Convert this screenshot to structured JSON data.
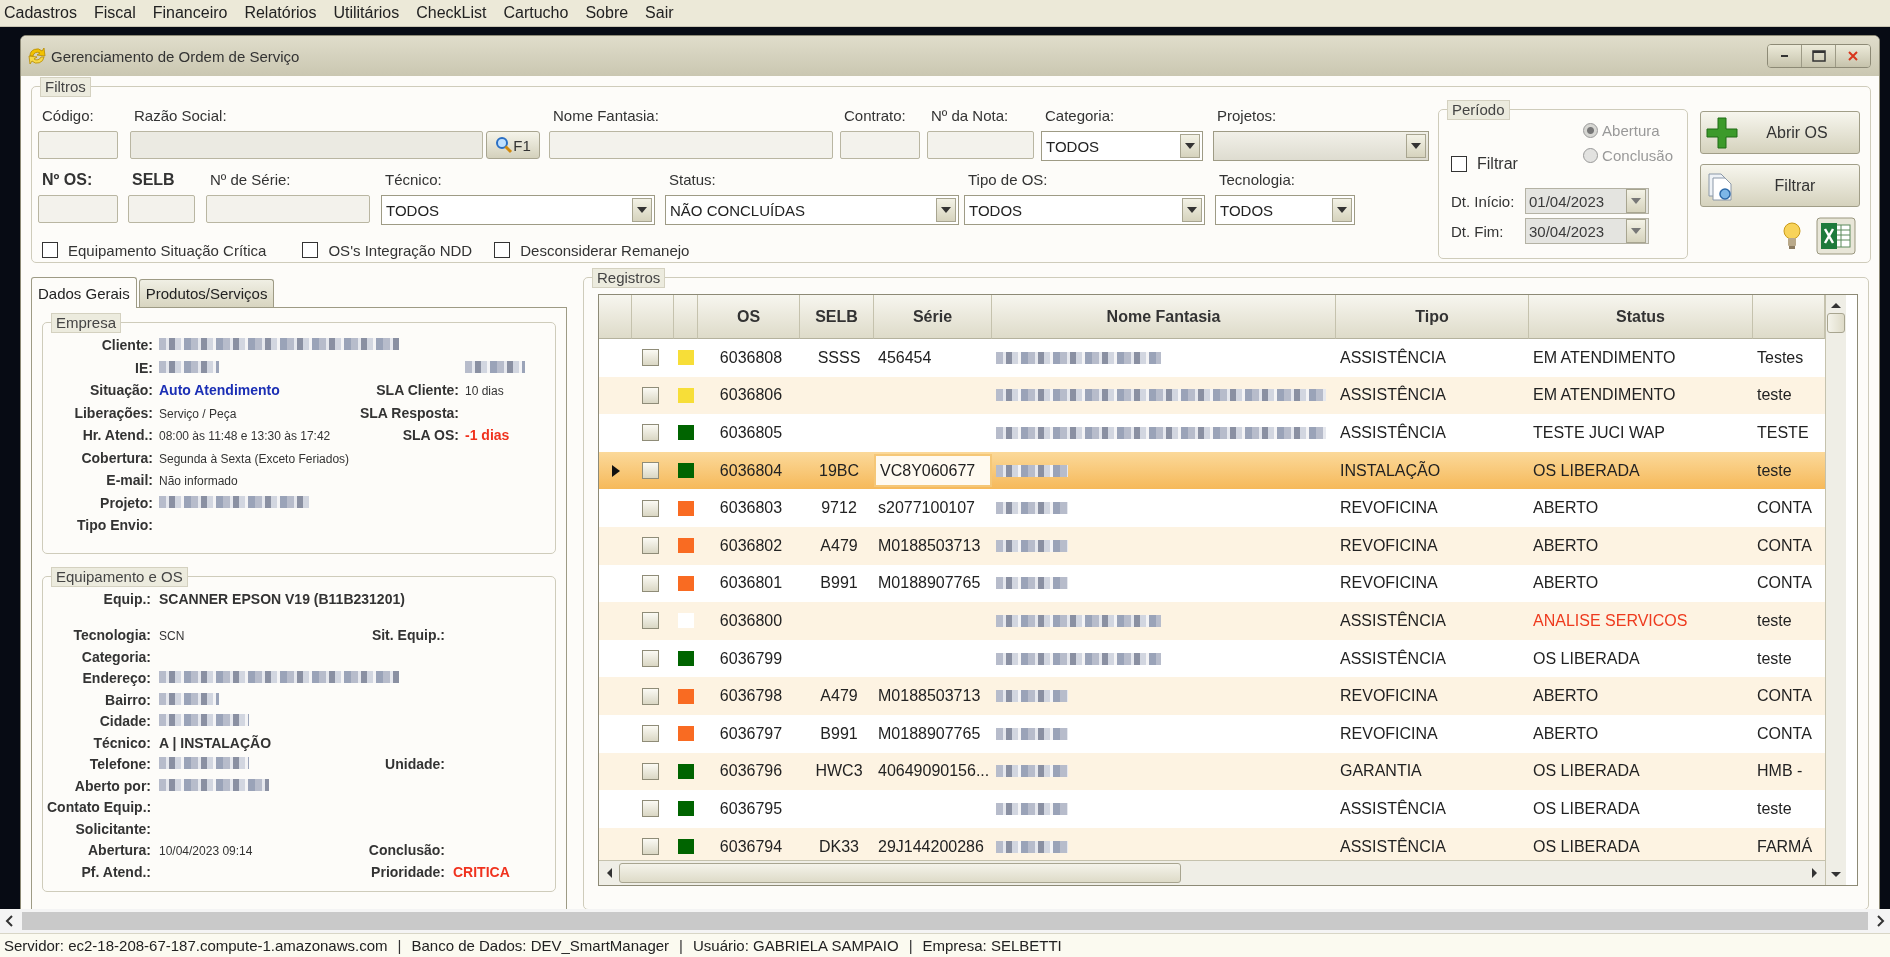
{
  "menu": [
    "Cadastros",
    "Fiscal",
    "Financeiro",
    "Relatórios",
    "Utilitários",
    "CheckList",
    "Cartucho",
    "Sobre",
    "Sair"
  ],
  "window": {
    "title": "Gerenciamento de Ordem de Serviço"
  },
  "filters": {
    "title": "Filtros",
    "search_button": "F1",
    "row1": [
      {
        "label": "Código:",
        "kind": "text",
        "bold": false
      },
      {
        "label": "Razão Social:",
        "kind": "lookup",
        "bold": false
      },
      {
        "label": "Nome Fantasia:",
        "kind": "text",
        "bold": false
      },
      {
        "label": "Contrato:",
        "kind": "text",
        "bold": false
      },
      {
        "label": "Nº da Nota:",
        "kind": "text",
        "bold": false
      },
      {
        "label": "Categoria:",
        "kind": "combo",
        "value": "TODOS",
        "bold": false
      },
      {
        "label": "Projetos:",
        "kind": "combo",
        "bold": false
      }
    ],
    "row2": [
      {
        "label": "Nº OS:",
        "kind": "text",
        "bold": true
      },
      {
        "label": "SELB",
        "kind": "text",
        "bold": true
      },
      {
        "label": "Nº de Série:",
        "kind": "text",
        "bold": false
      },
      {
        "label": "Técnico:",
        "kind": "combo",
        "value": "TODOS",
        "bold": false
      },
      {
        "label": "Status:",
        "kind": "combo",
        "value": "NÃO CONCLUÍDAS",
        "bold": false
      },
      {
        "label": "Tipo de OS:",
        "kind": "combo",
        "value": "TODOS",
        "bold": false
      },
      {
        "label": "Tecnologia:",
        "kind": "combo",
        "value": "TODOS",
        "bold": false
      }
    ],
    "checks": [
      {
        "label": "Equipamento Situação Crítica",
        "checked": false
      },
      {
        "label": "OS's Integração NDD",
        "checked": false
      },
      {
        "label": "Desconsiderar Remanejo",
        "checked": false
      }
    ]
  },
  "period": {
    "title": "Período",
    "disabled": true,
    "filter": {
      "label": "Filtrar",
      "checked": false
    },
    "options": [
      {
        "label": "Abertura",
        "selected": true
      },
      {
        "label": "Conclusão",
        "selected": false
      }
    ],
    "dates": [
      {
        "label": "Dt. Início:",
        "value": "01/04/2023"
      },
      {
        "label": "Dt. Fim:",
        "value": "30/04/2023"
      }
    ]
  },
  "actions": [
    {
      "label": "Abrir OS",
      "kind": "add"
    },
    {
      "label": "Filtrar",
      "kind": "filter"
    }
  ],
  "tabs": [
    {
      "label": "Dados Gerais",
      "selected": true
    },
    {
      "label": "Produtos/Serviços",
      "selected": false
    }
  ],
  "empresa": {
    "title": "Empresa",
    "rows": [
      {
        "label": "Cliente:",
        "kind": "redacted"
      },
      {
        "label": "IE:",
        "kind": "redacted",
        "right": {
          "kind": "redacted"
        }
      },
      {
        "label": "Situação:",
        "value": "Auto Atendimento",
        "kind": "link",
        "right": {
          "label": "SLA Cliente:",
          "value": "10 dias",
          "kind": "small"
        }
      },
      {
        "label": "Liberações:",
        "value": "Serviço / Peça",
        "kind": "small",
        "right": {
          "label": "SLA Resposta:"
        }
      },
      {
        "label": "Hr. Atend.:",
        "value": "08:00 às 11:48 e 13:30 às 17:42",
        "kind": "small",
        "right": {
          "label": "SLA OS:",
          "value": "-1 dias",
          "kind": "alert"
        }
      },
      {
        "label": "Cobertura:",
        "value": "Segunda à Sexta (Exceto Feriados)",
        "kind": "small"
      },
      {
        "label": "E-mail:",
        "value": "Não informado",
        "kind": "small"
      },
      {
        "label": "Projeto:",
        "kind": "redacted"
      },
      {
        "label": "Tipo Envio:"
      }
    ]
  },
  "equipamento": {
    "title": "Equipamento e OS",
    "rows": [
      {
        "label": "Equip.:",
        "value": "SCANNER EPSON V19 (B11B231201)",
        "kind": "bold"
      },
      {
        "label": "Tecnologia:",
        "value": "SCN",
        "kind": "small",
        "right": {
          "label": "Sit. Equip.:"
        }
      },
      {
        "label": "Categoria:"
      },
      {
        "label": "Endereço:",
        "kind": "redacted"
      },
      {
        "label": "Bairro:",
        "kind": "redacted"
      },
      {
        "label": "Cidade:",
        "kind": "redacted"
      },
      {
        "label": "Técnico:",
        "value": "A | INSTALAÇÃO",
        "kind": "bold"
      },
      {
        "label": "Telefone:",
        "kind": "redacted",
        "right": {
          "label": "Unidade:"
        }
      },
      {
        "label": "Aberto por:",
        "kind": "redacted"
      },
      {
        "label": "Contato Equip.:"
      },
      {
        "label": "Solicitante:"
      },
      {
        "label": "Abertura:",
        "value": "10/04/2023 09:14",
        "kind": "small",
        "right": {
          "label": "Conclusão:"
        }
      },
      {
        "label": "Pf. Atend.:",
        "right": {
          "label": "Prioridade:",
          "value": "CRITICA",
          "kind": "alert"
        }
      }
    ]
  },
  "registros": {
    "title": "Registros",
    "columns": [
      "OS",
      "SELB",
      "Série",
      "Nome Fantasia",
      "Tipo",
      "Status"
    ],
    "rows": [
      {
        "os": "6036808",
        "selb": "SSSS",
        "serie": "456454",
        "name_redacted": true,
        "tipo": "ASSISTÊNCIA",
        "status": "EM ATENDIMENTO",
        "alert": false,
        "extra": "Testes",
        "color": "#f7de38",
        "checked": false,
        "selected": false
      },
      {
        "os": "6036806",
        "name_redacted": true,
        "tipo": "ASSISTÊNCIA",
        "status": "EM ATENDIMENTO",
        "alert": false,
        "extra": "teste",
        "color": "#f7de38",
        "checked": false,
        "selected": false
      },
      {
        "os": "6036805",
        "name_redacted": true,
        "tipo": "ASSISTÊNCIA",
        "status": "TESTE JUCI WAP",
        "alert": false,
        "extra": "TESTE",
        "color": "#006400",
        "checked": false,
        "selected": false
      },
      {
        "os": "6036804",
        "selb": "19BC",
        "serie": "VC8Y060677",
        "name_redacted": true,
        "tipo": "INSTALAÇÃO",
        "status": "OS LIBERADA",
        "alert": false,
        "extra": "teste",
        "color": "#006400",
        "checked": false,
        "selected": true
      },
      {
        "os": "6036803",
        "selb": "9712",
        "serie": "s2077100107",
        "name_redacted": true,
        "tipo": "REVOFICINA",
        "status": "ABERTO",
        "alert": false,
        "extra": "CONTA",
        "color": "#f96b22",
        "checked": false,
        "selected": false
      },
      {
        "os": "6036802",
        "selb": "A479",
        "serie": "M0188503713",
        "name_redacted": true,
        "tipo": "REVOFICINA",
        "status": "ABERTO",
        "alert": false,
        "extra": "CONTA",
        "color": "#f96b22",
        "checked": false,
        "selected": false
      },
      {
        "os": "6036801",
        "selb": "B991",
        "serie": "M0188907765",
        "name_redacted": true,
        "tipo": "REVOFICINA",
        "status": "ABERTO",
        "alert": false,
        "extra": "CONTA",
        "color": "#f96b22",
        "checked": false,
        "selected": false
      },
      {
        "os": "6036800",
        "name_redacted": true,
        "tipo": "ASSISTÊNCIA",
        "status": "ANALISE SERVICOS",
        "alert": true,
        "extra": "teste",
        "color": "#ffffff",
        "checked": false,
        "selected": false
      },
      {
        "os": "6036799",
        "name_redacted": true,
        "tipo": "ASSISTÊNCIA",
        "status": "OS LIBERADA",
        "alert": false,
        "extra": "teste",
        "color": "#006400",
        "checked": false,
        "selected": false
      },
      {
        "os": "6036798",
        "selb": "A479",
        "serie": "M0188503713",
        "name_redacted": true,
        "tipo": "REVOFICINA",
        "status": "ABERTO",
        "alert": false,
        "extra": "CONTA",
        "color": "#f96b22",
        "checked": false,
        "selected": false
      },
      {
        "os": "6036797",
        "selb": "B991",
        "serie": "M0188907765",
        "name_redacted": true,
        "tipo": "REVOFICINA",
        "status": "ABERTO",
        "alert": false,
        "extra": "CONTA",
        "color": "#f96b22",
        "checked": false,
        "selected": false
      },
      {
        "os": "6036796",
        "selb": "HWC3",
        "serie": "40649090156...",
        "name_redacted": true,
        "tipo": "GARANTIA",
        "status": "OS LIBERADA",
        "alert": false,
        "extra": "HMB -",
        "color": "#006400",
        "checked": false,
        "selected": false
      },
      {
        "os": "6036795",
        "name_redacted": true,
        "tipo": "ASSISTÊNCIA",
        "status": "OS LIBERADA",
        "alert": false,
        "extra": "teste",
        "color": "#006400",
        "checked": false,
        "selected": false
      },
      {
        "os": "6036794",
        "selb": "DK33",
        "serie": "29J144200286",
        "name_redacted": true,
        "tipo": "ASSISTÊNCIA",
        "status": "OS LIBERADA",
        "alert": false,
        "extra": "FARMÁ",
        "color": "#006400",
        "checked": false,
        "selected": false
      }
    ]
  },
  "status_bar": {
    "separator": "|",
    "items": [
      {
        "label": "Servidor:",
        "value": "ec2-18-208-67-187.compute-1.amazonaws.com"
      },
      {
        "label": "Banco de Dados:",
        "value": "DEV_SmartManager"
      },
      {
        "label": "Usuário:",
        "value": "GABRIELA SAMPAIO"
      },
      {
        "label": "Empresa:",
        "value": "SELBETTI"
      }
    ]
  }
}
